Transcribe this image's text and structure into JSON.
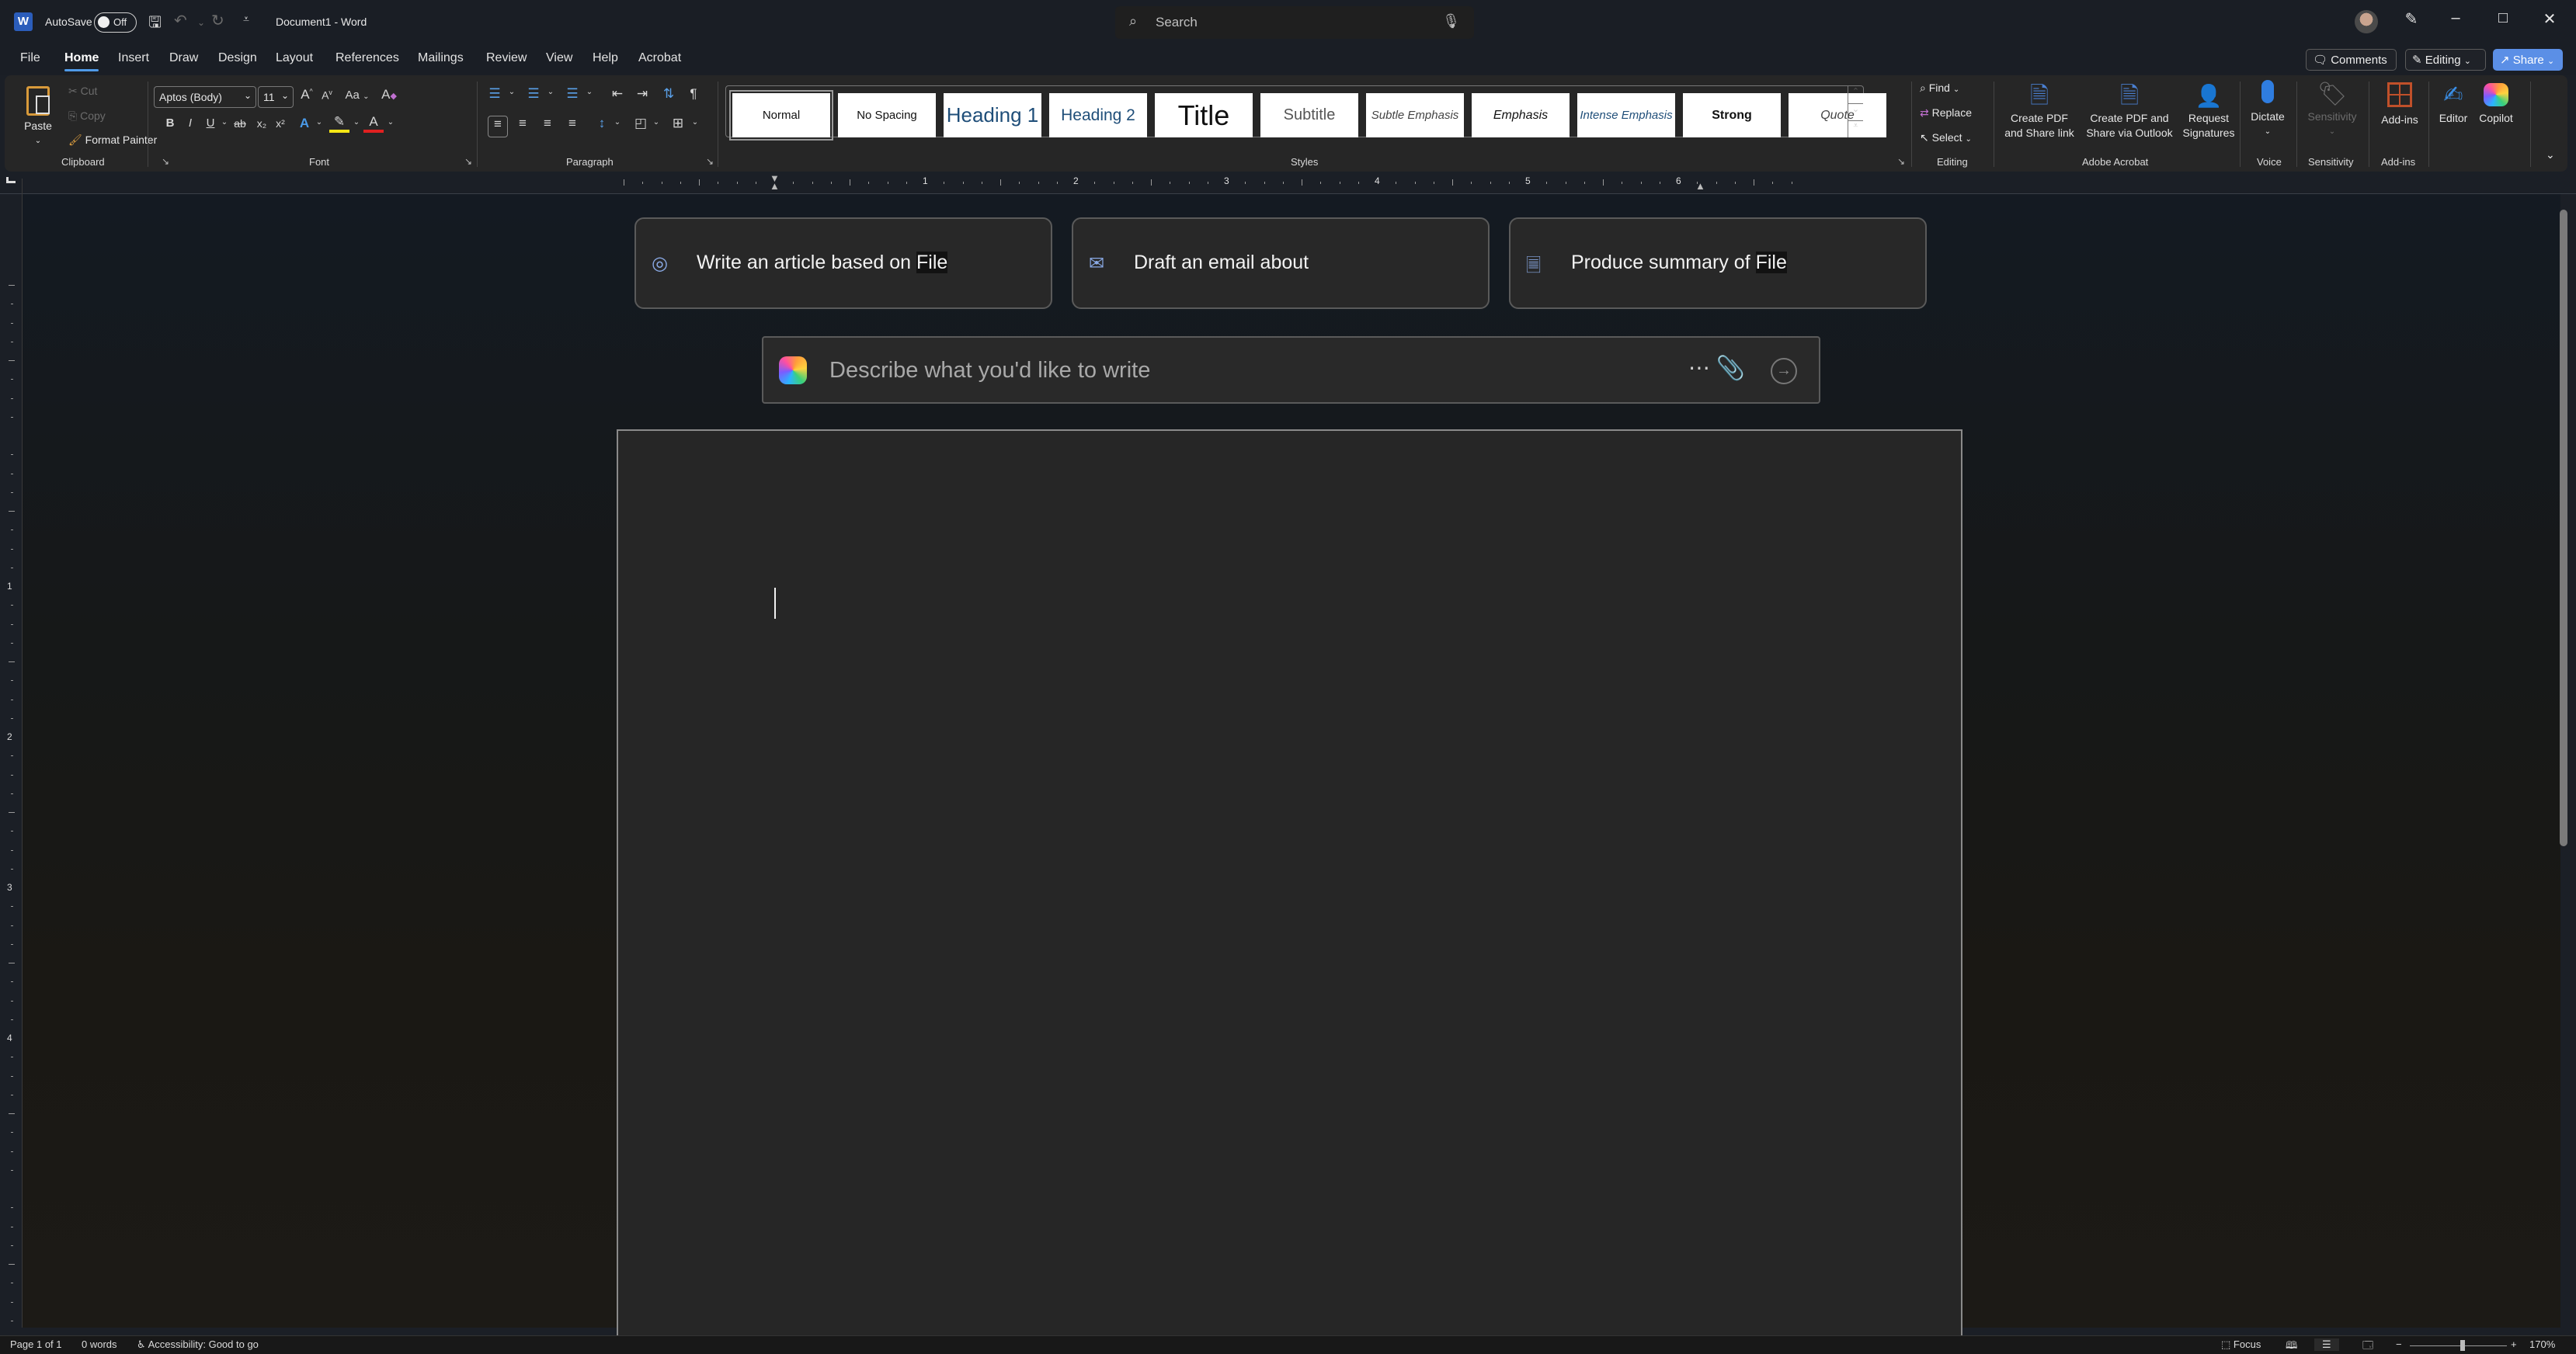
{
  "titlebar": {
    "app_icon": "word-logo-icon",
    "autosave_label": "AutoSave",
    "autosave_state": "Off",
    "doc_title": "Document1  -  Word",
    "search_placeholder": "Search",
    "icons": [
      "save-icon",
      "undo-icon",
      "redo-icon",
      "customize-quick-access-icon",
      "search-icon",
      "microphone-icon",
      "avatar",
      "pen-icon",
      "minimize-icon",
      "maximize-icon",
      "close-icon"
    ]
  },
  "menu": {
    "tabs": [
      "File",
      "Home",
      "Insert",
      "Draw",
      "Design",
      "Layout",
      "References",
      "Mailings",
      "Review",
      "View",
      "Help",
      "Acrobat"
    ],
    "active_tab": "Home",
    "comments_label": "Comments",
    "editing_label": "Editing",
    "share_label": "Share"
  },
  "ribbon": {
    "clipboard": {
      "label": "Clipboard",
      "paste": "Paste",
      "cut": "Cut",
      "copy": "Copy",
      "format_painter": "Format Painter"
    },
    "font": {
      "label": "Font",
      "font_name": "Aptos (Body)",
      "font_size": "11",
      "change_case": "Aa",
      "buttons": [
        "B",
        "I",
        "U",
        "ab",
        "x₂",
        "x²"
      ]
    },
    "paragraph": {
      "label": "Paragraph"
    },
    "styles": {
      "label": "Styles",
      "items": [
        "Normal",
        "No Spacing",
        "Heading 1",
        "Heading 2",
        "Title",
        "Subtitle",
        "Subtle Emphasis",
        "Emphasis",
        "Intense Emphasis",
        "Strong",
        "Quote"
      ],
      "selected": "Normal"
    },
    "editing": {
      "label": "Editing",
      "find": "Find",
      "replace": "Replace",
      "select": "Select"
    },
    "acrobat": {
      "label": "Adobe Acrobat",
      "create_pdf_link_1": "Create PDF",
      "create_pdf_link_2": "and Share link",
      "create_pdf_outlook_1": "Create PDF and",
      "create_pdf_outlook_2": "Share via Outlook",
      "request_sig_1": "Request",
      "request_sig_2": "Signatures"
    },
    "voice": {
      "label": "Voice",
      "dictate": "Dictate"
    },
    "sensitivity": {
      "label": "Sensitivity",
      "button": "Sensitivity"
    },
    "addins": {
      "label": "Add-ins",
      "button": "Add-ins"
    },
    "editor": "Editor",
    "copilot": "Copilot"
  },
  "ruler": {
    "numbers": [
      "1",
      "2",
      "3",
      "4",
      "5",
      "6"
    ],
    "vertical_numbers": [
      "1",
      "2",
      "3",
      "4"
    ]
  },
  "copilot": {
    "suggestions": [
      {
        "icon": "article-icon",
        "text": "Write an article based on ",
        "ref": "File"
      },
      {
        "icon": "mail-icon",
        "text": "Draft an email about",
        "ref": ""
      },
      {
        "icon": "summary-icon",
        "text": "Produce summary of ",
        "ref": "File"
      }
    ],
    "prompt_placeholder": "Describe what you'd like to write"
  },
  "statusbar": {
    "page": "Page 1 of 1",
    "words": "0 words",
    "accessibility": "Accessibility: Good to go",
    "focus": "Focus",
    "zoom_level": "170%",
    "zoom_fraction": 0.57
  },
  "colors": {
    "accent": "#4f9ae8",
    "share_button": "#5b8fe6",
    "heading_style": "#1f4e79",
    "highlight_yellow": "#f5e615",
    "font_color_red": "#e02020"
  }
}
